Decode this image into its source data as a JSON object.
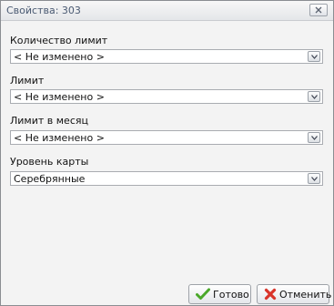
{
  "window": {
    "title": "Свойства: 303",
    "close_icon": "close-icon"
  },
  "fields": [
    {
      "label": "Количество лимит",
      "value": "< Не изменено >"
    },
    {
      "label": "Лимит",
      "value": "< Не изменено >"
    },
    {
      "label": "Лимит в месяц",
      "value": "< Не изменено >"
    },
    {
      "label": "Уровень карты",
      "value": "Серебрянные"
    }
  ],
  "buttons": {
    "ok": {
      "label": "Готово",
      "icon": "checkmark-icon",
      "color": "#4aa82a"
    },
    "cancel": {
      "label": "Отменить",
      "icon": "red-x-icon",
      "color": "#d9342a"
    }
  }
}
